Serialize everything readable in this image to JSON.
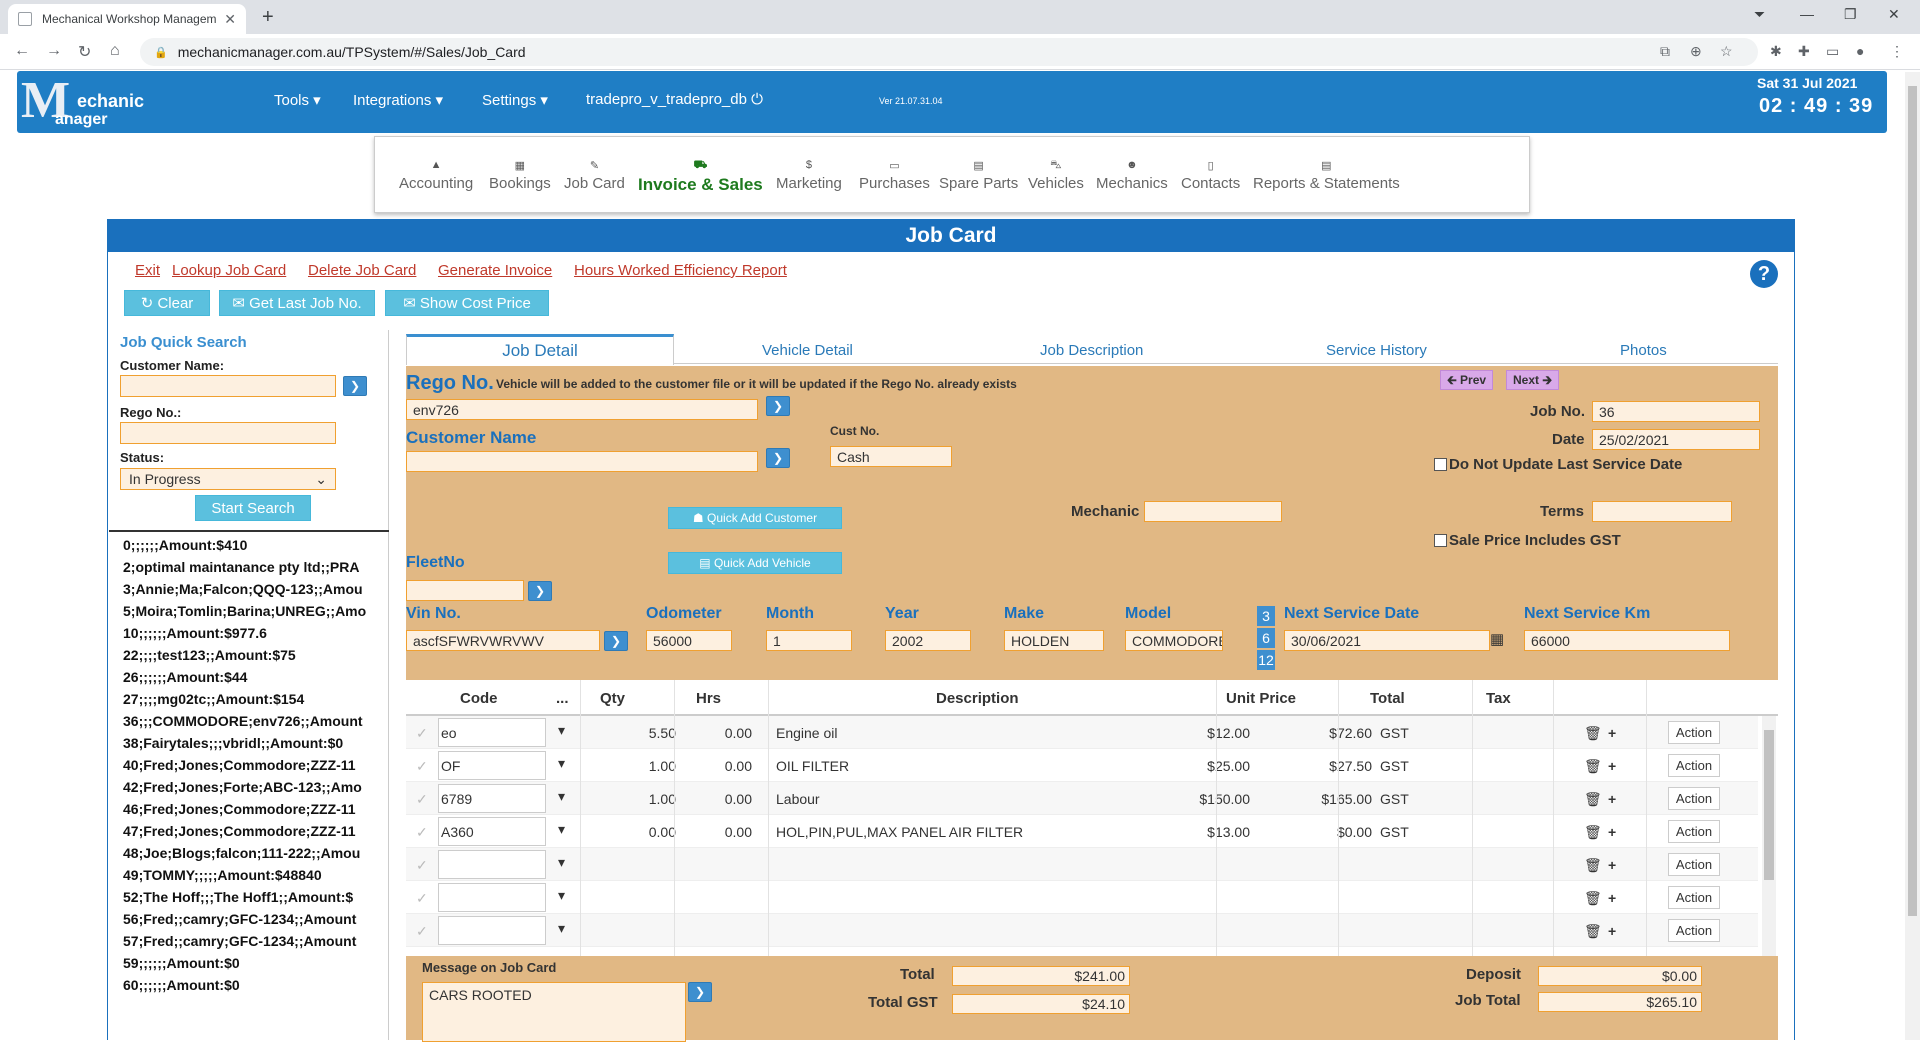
{
  "browser": {
    "tab_title": "Mechanical Workshop Managem",
    "url": "mechanicmanager.com.au/TPSystem/#/Sales/Job_Card"
  },
  "header": {
    "logo_m": "M",
    "logo_line1": "echanic",
    "logo_line2": "anager",
    "menu": [
      "Tools ▾",
      "Integrations ▾",
      "Settings ▾"
    ],
    "db_name": "tradepro_v_tradepro_db ⏻",
    "version": "Ver 21.07.31.04",
    "date": "Sat 31 Jul 2021",
    "time": "02 : 49 : 39"
  },
  "modules": [
    {
      "icon": "▲",
      "label": "Accounting"
    },
    {
      "icon": "▦",
      "label": "Bookings"
    },
    {
      "icon": "✎",
      "label": "Job Card"
    },
    {
      "icon": "⛟",
      "label": "Invoice & Sales"
    },
    {
      "icon": "$",
      "label": "Marketing"
    },
    {
      "icon": "▭",
      "label": "Purchases"
    },
    {
      "icon": "▤",
      "label": "Spare Parts"
    },
    {
      "icon": "⛍",
      "label": "Vehicles"
    },
    {
      "icon": "☻",
      "label": "Mechanics"
    },
    {
      "icon": "▯",
      "label": "Contacts"
    },
    {
      "icon": "▤",
      "label": "Reports & Statements"
    }
  ],
  "page_title": "Job Card",
  "links": [
    "Exit",
    "Lookup Job Card",
    "Delete Job Card",
    "Generate Invoice",
    "Hours Worked Efficiency Report"
  ],
  "top_buttons": {
    "clear": "↻ Clear",
    "last_job": "✉ Get Last Job No.",
    "cost": "✉ Show Cost Price"
  },
  "quick_search": {
    "title": "Job Quick Search",
    "customer_label": "Customer Name:",
    "rego_label": "Rego No.:",
    "status_label": "Status:",
    "status_value": "In Progress",
    "search_button": "Start Search",
    "results": [
      "0;;;;;;Amount:$410",
      "2;optimal maintanance pty ltd;;PRA",
      "3;Annie;Ma;Falcon;QQQ-123;;Amou",
      "5;Moira;Tomlin;Barina;UNREG;;Amo",
      "10;;;;;;Amount:$977.6",
      "22;;;;test123;;Amount:$75",
      "26;;;;;;Amount:$44",
      "27;;;;mg02tc;;Amount:$154",
      "36;;;COMMODORE;env726;;Amount",
      "38;Fairytales;;;vbridl;;Amount:$0",
      "40;Fred;Jones;Commodore;ZZZ-11",
      "42;Fred;Jones;Forte;ABC-123;;Amo",
      "46;Fred;Jones;Commodore;ZZZ-11",
      "47;Fred;Jones;Commodore;ZZZ-11",
      "48;Joe;Blogs;falcon;111-222;;Amou",
      "49;TOMMY;;;;;Amount:$48840",
      "52;The Hoff;;;The Hoff1;;Amount:$",
      "56;Fred;;camry;GFC-1234;;Amount",
      "57;Fred;;camry;GFC-1234;;Amount",
      "59;;;;;;Amount:$0",
      "60;;;;;;Amount:$0"
    ]
  },
  "tabs": [
    "Job Detail",
    "Vehicle Detail",
    "Job Description",
    "Service History",
    "Photos"
  ],
  "detail": {
    "rego_label": "Rego No.",
    "rego_note": "Vehicle will be added to the customer file or it will be updated if the Rego No. already exists",
    "rego_value": "env726",
    "prev": "🡰 Prev",
    "next": "Next 🡲",
    "job_no_label": "Job No.",
    "job_no": "36",
    "date_label": "Date",
    "date": "25/02/2021",
    "customer_label": "Customer Name",
    "cust_no_label": "Cust No.",
    "cust_no": "Cash",
    "no_update_label": "Do Not Update Last Service Date",
    "quick_add_customer": "☗ Quick Add Customer",
    "quick_add_vehicle": "▤ Quick Add Vehicle",
    "mechanic_label": "Mechanic",
    "terms_label": "Terms",
    "gst_label": "Sale Price Includes GST",
    "fleet_label": "FleetNo",
    "vin_label": "Vin No.",
    "vin": "ascfSFWRVWRVWV",
    "odometer_label": "Odometer",
    "odometer": "56000",
    "month_label": "Month",
    "month": "1",
    "year_label": "Year",
    "year": "2002",
    "make_label": "Make",
    "make": "HOLDEN",
    "model_label": "Model",
    "model": "COMMODORE",
    "badges": [
      "3",
      "6",
      "12"
    ],
    "next_service_date_label": "Next Service Date",
    "next_service_date": "30/06/2021",
    "next_service_km_label": "Next Service Km",
    "next_service_km": "66000"
  },
  "grid": {
    "headers": [
      "Code",
      "...",
      "Qty",
      "Hrs",
      "Description",
      "Unit Price",
      "Total",
      "Tax"
    ],
    "rows": [
      {
        "code": "eo",
        "qty": "5.50",
        "hrs": "0.00",
        "desc": "Engine oil",
        "unit": "$12.00",
        "total": "$72.60",
        "tax": "GST"
      },
      {
        "code": "OF",
        "qty": "1.00",
        "hrs": "0.00",
        "desc": "OIL FILTER",
        "unit": "$25.00",
        "total": "$27.50",
        "tax": "GST"
      },
      {
        "code": "6789",
        "qty": "1.00",
        "hrs": "0.00",
        "desc": "Labour",
        "unit": "$150.00",
        "total": "$165.00",
        "tax": "GST"
      },
      {
        "code": "A360",
        "qty": "0.00",
        "hrs": "0.00",
        "desc": "HOL,PIN,PUL,MAX PANEL AIR FILTER",
        "unit": "$13.00",
        "total": "$0.00",
        "tax": "GST"
      },
      {
        "code": "",
        "qty": "",
        "hrs": "",
        "desc": "",
        "unit": "",
        "total": "",
        "tax": ""
      },
      {
        "code": "",
        "qty": "",
        "hrs": "",
        "desc": "",
        "unit": "",
        "total": "",
        "tax": ""
      },
      {
        "code": "",
        "qty": "",
        "hrs": "",
        "desc": "",
        "unit": "",
        "total": "",
        "tax": ""
      }
    ],
    "action_label": "Action"
  },
  "footer": {
    "message_label": "Message on Job Card",
    "message": "CARS ROOTED",
    "total_label": "Total",
    "total": "$241.00",
    "gst_label": "Total GST",
    "gst": "$24.10",
    "deposit_label": "Deposit",
    "deposit": "$0.00",
    "job_total_label": "Job Total",
    "job_total": "$265.10"
  }
}
